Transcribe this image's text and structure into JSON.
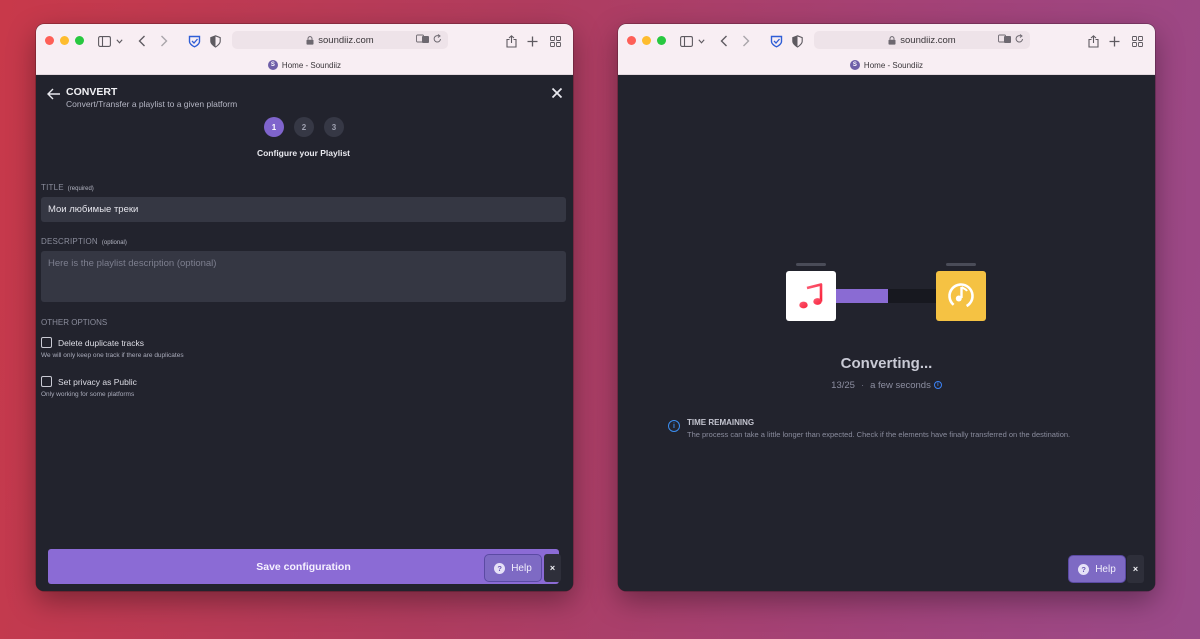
{
  "browser": {
    "url": "soundiiz.com",
    "tab_title": "Home - Soundiiz",
    "favicon_letter": "S"
  },
  "left_window": {
    "header": {
      "title": "CONVERT",
      "subtitle": "Convert/Transfer a playlist to a given platform"
    },
    "steps": [
      {
        "label": "1",
        "active": true
      },
      {
        "label": "2",
        "active": false
      },
      {
        "label": "3",
        "active": false
      }
    ],
    "step_title": "Configure your Playlist",
    "form": {
      "title_label": "TITLE",
      "title_hint": "(required)",
      "title_value": "Мои любимые треки",
      "description_label": "DESCRIPTION",
      "description_hint": "(optional)",
      "description_placeholder": "Here is the playlist description (optional)",
      "other_options_label": "OTHER OPTIONS",
      "options": [
        {
          "label": "Delete duplicate tracks",
          "help": "We will only keep one track if there are duplicates",
          "checked": false
        },
        {
          "label": "Set privacy as Public",
          "help": "Only working for some platforms",
          "checked": false
        }
      ]
    },
    "save_button": "Save configuration",
    "help_button": "Help",
    "help_close": "×"
  },
  "right_window": {
    "source_platform_icon": "apple-music-icon",
    "destination_platform_icon": "yandex-music-icon",
    "progress": {
      "done": 13,
      "total": 25
    },
    "status_title": "Converting...",
    "count_text": "13/25",
    "eta_text": "a few seconds",
    "time_remaining_title": "TIME REMAINING",
    "time_remaining_text": "The process can take a little longer than expected. Check if the elements have finally transferred on the destination.",
    "help_button": "Help",
    "help_close": "×"
  },
  "colors": {
    "accent": "#8b6bd5",
    "panel_bg": "#22232d",
    "info_blue": "#3b8ef0",
    "destination_yellow": "#f5c243"
  }
}
